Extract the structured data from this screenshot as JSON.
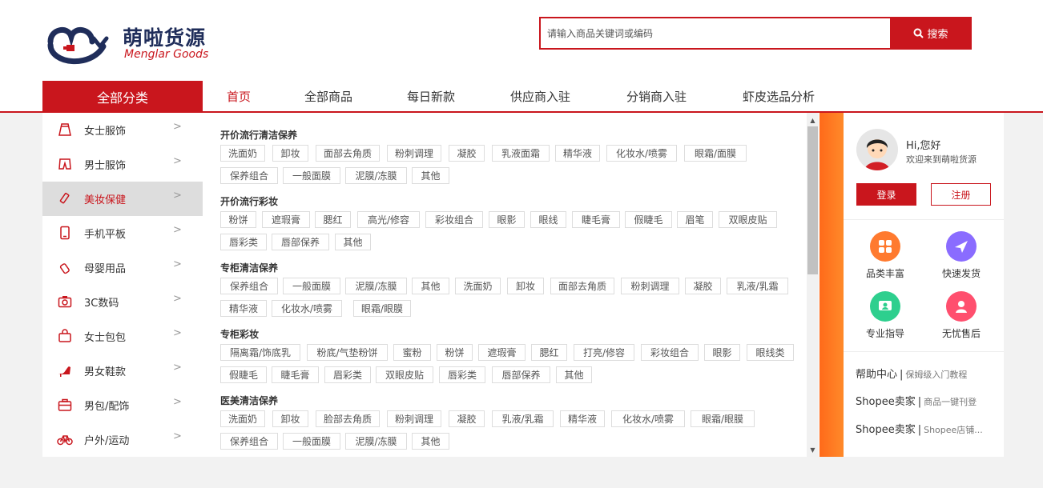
{
  "header": {
    "brand_cn": "萌啦货源",
    "brand_en": "Menglar Goods",
    "search": {
      "placeholder": "请输入商品关键词或编码",
      "button_label": "搜索"
    }
  },
  "nav": {
    "all_categories": "全部分类",
    "links": [
      "首页",
      "全部商品",
      "每日新款",
      "供应商入驻",
      "分销商入驻",
      "虾皮选品分析"
    ],
    "active": "首页"
  },
  "categories": [
    {
      "label": "女士服饰",
      "icon": "skirt-icon"
    },
    {
      "label": "男士服饰",
      "icon": "shorts-icon"
    },
    {
      "label": "美妆保健",
      "icon": "cosmetics-icon"
    },
    {
      "label": "手机平板",
      "icon": "phone-icon"
    },
    {
      "label": "母婴用品",
      "icon": "baby-bottle-icon"
    },
    {
      "label": "3C数码",
      "icon": "camera-icon"
    },
    {
      "label": "女士包包",
      "icon": "handbag-icon"
    },
    {
      "label": "男女鞋款",
      "icon": "high-heel-icon"
    },
    {
      "label": "男包/配饰",
      "icon": "briefcase-icon"
    },
    {
      "label": "户外/运动",
      "icon": "bicycle-icon"
    }
  ],
  "active_category": "美妆保健",
  "subcategories": [
    {
      "title": "开价流行清洁保养",
      "tags": [
        "洗面奶",
        "卸妆",
        "面部去角质",
        "粉刺调理",
        "凝胶",
        "乳液面霜",
        "精华液",
        "化妆水/喷雾",
        "眼霜/面膜",
        "保养组合",
        "一般面膜",
        "泥膜/冻膜",
        "其他"
      ]
    },
    {
      "title": "开价流行彩妆",
      "tags": [
        "粉饼",
        "遮瑕膏",
        "腮红",
        "高光/修容",
        "彩妆组合",
        "眼影",
        "眼线",
        "睫毛膏",
        "假睫毛",
        "眉笔",
        "双眼皮贴",
        "唇彩类",
        "唇部保养",
        "其他"
      ]
    },
    {
      "title": "专柜清洁保养",
      "tags": [
        "保养组合",
        "一般面膜",
        "泥膜/冻膜",
        "其他",
        "洗面奶",
        "卸妆",
        "面部去角质",
        "粉刺调理",
        "凝胶",
        "乳液/乳霜",
        "精华液",
        "化妆水/喷雾",
        "眼霜/眼膜"
      ]
    },
    {
      "title": "专柜彩妆",
      "tags": [
        "隔离霜/饰底乳",
        "粉底/气垫粉饼",
        "蜜粉",
        "粉饼",
        "遮瑕膏",
        "腮红",
        "打亮/修容",
        "彩妆组合",
        "眼影",
        "眼线类",
        "假睫毛",
        "睫毛膏",
        "眉彩类",
        "双眼皮贴",
        "唇彩类",
        "唇部保养",
        "其他"
      ]
    },
    {
      "title": "医美清洁保养",
      "tags": [
        "洗面奶",
        "卸妆",
        "脸部去角质",
        "粉刺调理",
        "凝胶",
        "乳液/乳霜",
        "精华液",
        "化妆水/喷雾",
        "眼霜/眼膜",
        "保养组合",
        "一般面膜",
        "泥膜/冻膜",
        "其他"
      ]
    }
  ],
  "user": {
    "greeting": "Hi,您好",
    "welcome": "欢迎来到萌啦货源",
    "login_label": "登录",
    "register_label": "注册"
  },
  "features": [
    {
      "label": "品类丰富",
      "icon": "grid-icon",
      "color": "#ff7a2f"
    },
    {
      "label": "快速发货",
      "icon": "plane-icon",
      "color": "#8a6cff"
    },
    {
      "label": "专业指导",
      "icon": "guide-icon",
      "color": "#2ecf8e"
    },
    {
      "label": "无忧售后",
      "icon": "support-icon",
      "color": "#ff4f6e"
    }
  ],
  "help_links": [
    {
      "main": "帮助中心",
      "sub": "保姆级入门教程"
    },
    {
      "main": "Shopee卖家",
      "sub": "商品一键刊登"
    },
    {
      "main": "Shopee卖家",
      "sub": "Shopee店铺..."
    }
  ],
  "colors": {
    "brand_red": "#c9161d",
    "accent_orange": "#ff6a1a"
  }
}
